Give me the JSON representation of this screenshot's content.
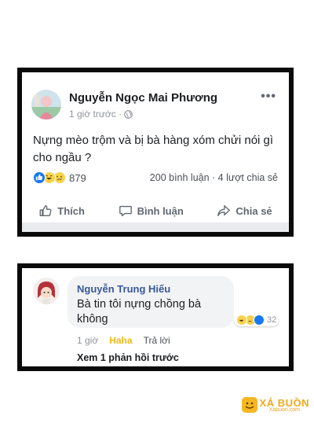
{
  "post": {
    "author": "Nguyễn Ngọc Mai Phương",
    "time": "1 giờ trước ·",
    "more": "•••",
    "text": "Nựng mèo trộm và bị bà hàng xóm chửi nói gì cho ngầu ?",
    "reaction_count": "879",
    "stats": "200 bình luận · 4 lượt chia sẻ",
    "actions": {
      "like": "Thích",
      "comment": "Bình luận",
      "share": "Chia sẻ"
    },
    "icons": {
      "globe": "globe-icon",
      "like": "thumbs-up-icon",
      "comment": "speech-bubble-icon",
      "share": "share-arrow-icon"
    }
  },
  "comment": {
    "author": "Nguyễn Trung Hiếu",
    "text": "Bà tin tôi nựng chồng bà không",
    "reaction_count": "32",
    "time": "1 giờ",
    "reaction_label": "Haha",
    "reply_label": "Trả lời",
    "view_replies": "Xem 1 phản hồi trước"
  },
  "watermark": {
    "name": "XẢ BUỒN",
    "url": "Xabuon.com"
  },
  "colors": {
    "frame": "#0a0a0a",
    "fb_blue": "#1877f2",
    "haha_yellow": "#f0ba15",
    "author_link": "#385898"
  }
}
